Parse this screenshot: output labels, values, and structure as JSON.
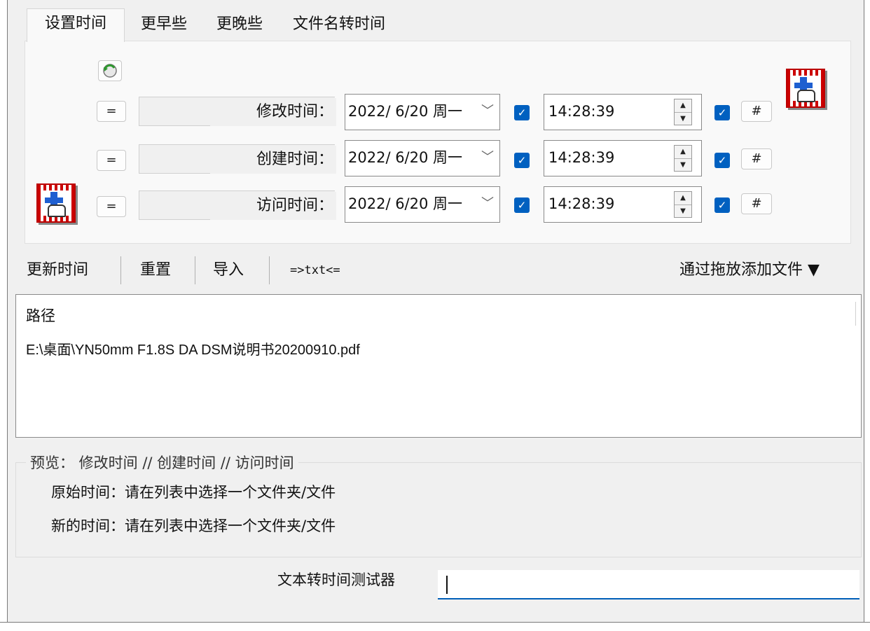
{
  "tabs": [
    {
      "label": "设置时间",
      "active": true
    },
    {
      "label": "更早些",
      "active": false
    },
    {
      "label": "更晚些",
      "active": false
    },
    {
      "label": "文件名转时间",
      "active": false
    }
  ],
  "refresh_icon": "refresh-green-icon",
  "rows": [
    {
      "eq_label": "=",
      "label": "修改时间：",
      "date": "2022/  6/20 周一",
      "date_checked": true,
      "time": "14:28:39",
      "time_checked": true,
      "hash_label": "#"
    },
    {
      "eq_label": "=",
      "label": "创建时间：",
      "date": "2022/  6/20 周一",
      "date_checked": true,
      "time": "14:28:39",
      "time_checked": true,
      "hash_label": "#"
    },
    {
      "eq_label": "=",
      "label": "访问时间：",
      "date": "2022/  6/20 周一",
      "date_checked": true,
      "time": "14:28:39",
      "time_checked": true,
      "hash_label": "#"
    }
  ],
  "toolbar": {
    "update": "更新时间",
    "reset": "重置",
    "import": "导入",
    "txt": "=>txt<=",
    "drag_add": "通过拖放添加文件 ▼"
  },
  "list": {
    "header": "路径",
    "items": [
      "E:\\桌面\\YN50mm F1.8S DA DSM说明书20200910.pdf"
    ]
  },
  "preview": {
    "legend": "预览：  修改时间   //  创建时间   //  访问时间",
    "original": "原始时间：请在列表中选择一个文件夹/文件",
    "new": "新的时间：请在列表中选择一个文件夹/文件"
  },
  "tester": {
    "label": "文本转时间测试器",
    "value": ""
  },
  "colors": {
    "accent": "#005fb8",
    "checkbox": "#0060c0",
    "icon_red": "#cc0000"
  }
}
